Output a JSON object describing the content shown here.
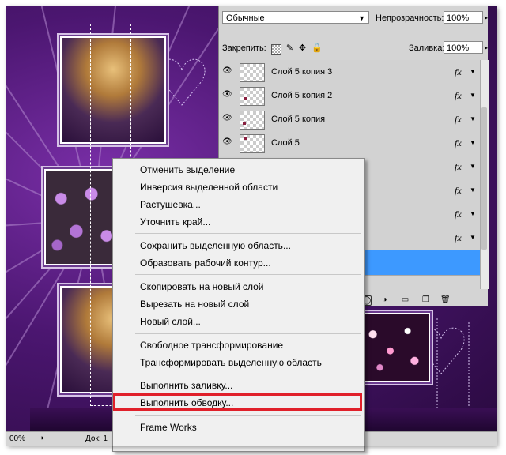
{
  "layers_panel": {
    "blend_mode": "Обычные",
    "opacity_label": "Непрозрачность:",
    "opacity_value": "100%",
    "lock_label": "Закрепить:",
    "fill_label": "Заливка:",
    "fill_value": "100%",
    "layers": [
      {
        "name": "Слой 5 копия 3",
        "fx": "fx"
      },
      {
        "name": "Слой 5 копия 2",
        "fx": "fx"
      },
      {
        "name": "Слой 5 копия",
        "fx": "fx"
      },
      {
        "name": "Слой 5",
        "fx": "fx"
      },
      {
        "name": "",
        "fx": "fx"
      },
      {
        "name": "",
        "fx": "fx"
      },
      {
        "name": "",
        "fx": "fx"
      },
      {
        "name": "",
        "fx": "fx"
      },
      {
        "name": "",
        "fx": "",
        "selected": true
      }
    ]
  },
  "context_menu": {
    "groups": [
      [
        "Отменить выделение",
        "Инверсия выделенной области",
        "Растушевка...",
        "Уточнить край..."
      ],
      [
        "Сохранить выделенную область...",
        "Образовать рабочий контур..."
      ],
      [
        "Скопировать на новый слой",
        "Вырезать на новый слой",
        "Новый слой..."
      ],
      [
        "Свободное трансформирование",
        "Трансформировать выделенную область"
      ],
      [
        "Выполнить заливку..."
      ],
      [
        "Выполнить обводку..."
      ],
      [
        "Frame Works"
      ]
    ],
    "highlighted": "Выполнить обводку..."
  },
  "status_bar": {
    "zoom": "00%",
    "doc": "Док: 1"
  },
  "colors": {
    "selection_blue": "#3d99ff",
    "highlight_red": "#e0202a"
  }
}
